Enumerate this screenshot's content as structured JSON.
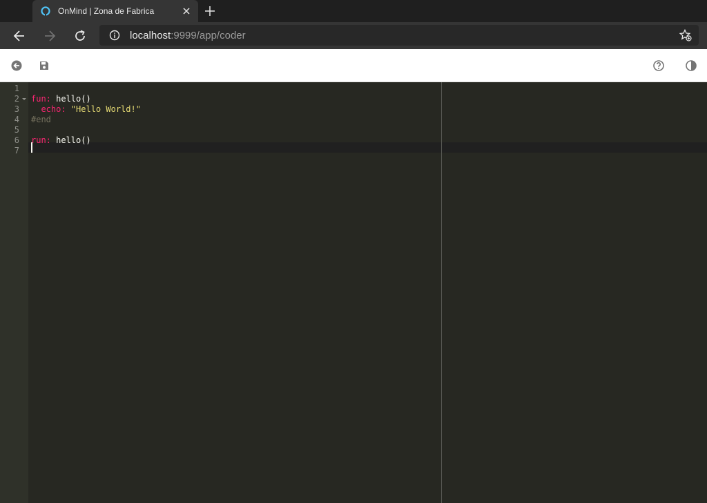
{
  "browser": {
    "tab": {
      "title": "OnMind | Zona de Fabrica",
      "favicon": "onmind-favicon-icon"
    },
    "address": {
      "host": "localhost",
      "rest": ":9999/app/coder"
    }
  },
  "colors": {
    "keyword": "#f92672",
    "string": "#e6db74",
    "comment": "#75715e",
    "text": "#f8f8f2",
    "editor_bg": "#272822",
    "gutter_bg": "#2f3129"
  },
  "editor": {
    "line_numbers": [
      "1",
      "2",
      "3",
      "4",
      "5",
      "6",
      "7"
    ],
    "lines": [
      {
        "parts": []
      },
      {
        "parts": [
          {
            "t": "fun:",
            "c": "kw"
          },
          {
            "t": " hello()",
            "c": ""
          }
        ]
      },
      {
        "parts": [
          {
            "t": "  echo:",
            "c": "kw"
          },
          {
            "t": " ",
            "c": ""
          },
          {
            "t": "\"Hello World!\"",
            "c": "str"
          }
        ]
      },
      {
        "parts": [
          {
            "t": "#end",
            "c": "cmt"
          }
        ]
      },
      {
        "parts": []
      },
      {
        "parts": [
          {
            "t": "run:",
            "c": "kw"
          },
          {
            "t": " hello()",
            "c": ""
          }
        ]
      },
      {
        "parts": []
      }
    ],
    "fold_line": 2,
    "active_line": 7
  },
  "toolbar": {
    "left_icons": [
      "back-circle-icon",
      "save-icon"
    ],
    "right_icons": [
      "help-icon",
      "theme-contrast-icon"
    ]
  }
}
